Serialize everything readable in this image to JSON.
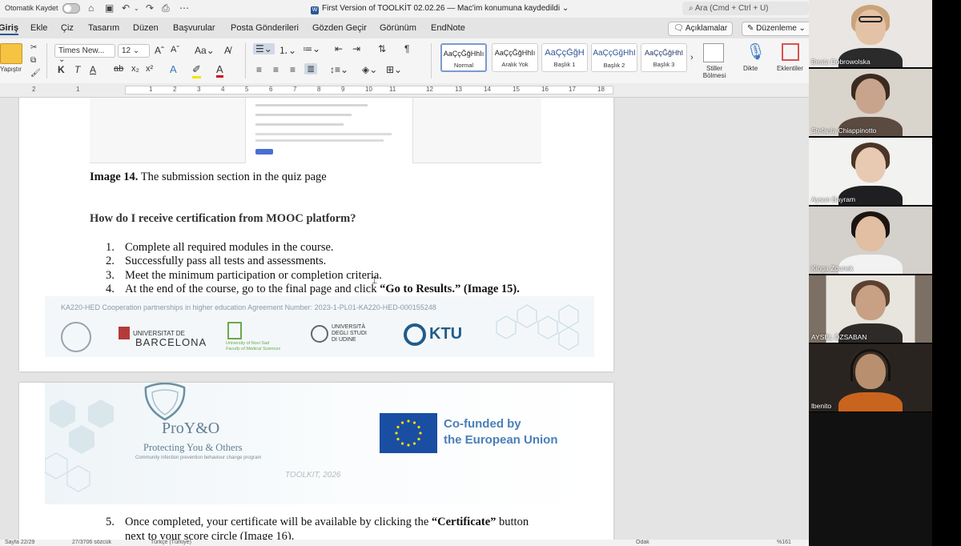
{
  "titlebar": {
    "autosave_label": "Otomatik Kaydet",
    "document_title": "First Version of TOOLKİT 02.02.26 — Mac'im konumuna kaydedildi ⌄",
    "search_placeholder": "Ara (Cmd + Ctrl + U)"
  },
  "menu": {
    "tabs": [
      "Giriş",
      "Ekle",
      "Çiz",
      "Tasarım",
      "Düzen",
      "Başvurular",
      "Posta Gönderileri",
      "Gözden Geçir",
      "Görünüm",
      "EndNote"
    ],
    "active_tab": "Giriş",
    "comments_button": "Açıklamalar",
    "editing_button": "Düzenleme"
  },
  "ribbon": {
    "paste_label": "Yapıştır",
    "font_name": "Times New...",
    "font_size": "12",
    "styles": [
      {
        "preview": "AaÇçĞğHhIı",
        "name": "Normal"
      },
      {
        "preview": "AaÇçĞğHhIı",
        "name": "Aralık Yok"
      },
      {
        "preview": "AaÇçĞğH",
        "name": "Başlık 1"
      },
      {
        "preview": "AaÇçĞğHhI",
        "name": "Başlık 2"
      },
      {
        "preview": "AaÇçĞğHhI",
        "name": "Başlık 3"
      }
    ],
    "styles_pane_label": "Stiller Bölmesi",
    "dictate_label": "Dikte",
    "addins_label": "Eklentiler"
  },
  "ruler": {
    "numbers": [
      "2",
      "1",
      "1",
      "2",
      "3",
      "4",
      "5",
      "6",
      "7",
      "8",
      "9",
      "10",
      "11",
      "12",
      "13",
      "14",
      "15",
      "16",
      "17",
      "18"
    ]
  },
  "document": {
    "image_caption_bold": "Image 14.",
    "image_caption_rest": " The submission section in the quiz page",
    "section_heading": "How do I receive certification from MOOC platform?",
    "steps": [
      {
        "num": "1.",
        "text": "Complete all required modules in the course.",
        "bold": ""
      },
      {
        "num": "2.",
        "text": "Successfully pass all tests and assessments.",
        "bold": ""
      },
      {
        "num": "3.",
        "text": "Meet the minimum participation or completion criteria.",
        "bold": ""
      },
      {
        "num": "4.",
        "text": "At the end of the course, go to the final page and click ",
        "bold": "“Go to Results.” (Image 15)."
      }
    ],
    "footer_agreement": "KA220-HED Cooperation partnerships in higher education  Agreement Number: 2023-1-PL01-KA220-HED-000155248",
    "logos": {
      "barcelona_top": "UNIVERSITAT DE",
      "barcelona_bottom": "BARCELONA",
      "nis_line1": "University of Novi Sad",
      "nis_line2": "Faculty of Medical Sciences",
      "udine_line1": "UNIVERSITÀ",
      "udine_line2": "DEGLI STUDI",
      "udine_line3": "DI UDINE",
      "ktu": "KTU"
    },
    "header": {
      "project_name": "ProY&O",
      "tagline": "Protecting You & Others",
      "subtagline": "Community infection prevention behaviour change program",
      "cofunded_line1": "Co-funded by",
      "cofunded_line2": "the European Union",
      "toolkit_label": "TOOLKIT, 2026"
    },
    "step5_num": "5.",
    "step5_text": "Once completed, your certificate will be available by clicking the ",
    "step5_bold": "“Certificate”",
    "step5_tail": " button",
    "step5_line2": "next to your score circle (Image 16)."
  },
  "statusbar": {
    "page": "Sayfa 22/29",
    "words": "27/3706 sözcük",
    "language": "Türkçe (Türkiye)",
    "focus": "Odak",
    "zoom": "%161"
  },
  "participants": [
    {
      "name": "Beata Dobrowolska"
    },
    {
      "name": "Stefania Chiappinotto"
    },
    {
      "name": "Aysun Bayram"
    },
    {
      "name": "Kinga Zdunek"
    },
    {
      "name": "AYSEL ÖZSABAN"
    },
    {
      "name": "lbenito"
    }
  ]
}
